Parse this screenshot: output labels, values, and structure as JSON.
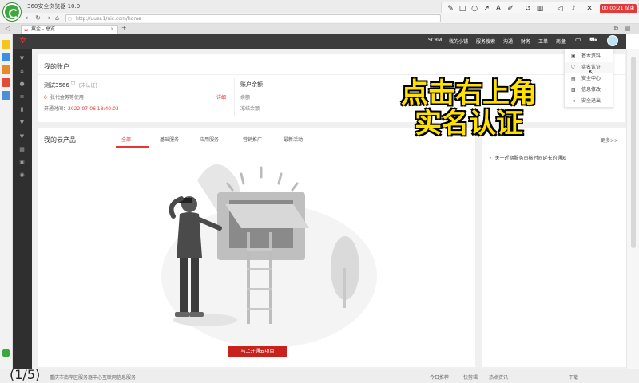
{
  "browser": {
    "title": "360安全浏览器 10.0",
    "url": "http://uuer.1/nic.com/home",
    "tab_label": "翼企 - 总览",
    "tab_close": "×",
    "new_tab": "+"
  },
  "recorder": {
    "timer": "00:00:21 结束"
  },
  "site": {
    "nav": [
      "SCRM",
      "我的小铺",
      "服务搜索",
      "沟通",
      "财务",
      "工单",
      "商盘"
    ]
  },
  "account": {
    "title": "我的账户",
    "username": "测试3566",
    "verify_status": "[未认证]",
    "pending_count": "0",
    "pending_text": "张代金券等使用",
    "details_link": "详细",
    "open_time_label": "开通时间：",
    "open_time_value": "2022-07-06 18:40:03",
    "balance_title": "账户余额",
    "balance_label": "余额",
    "frozen_label": "冻结余额"
  },
  "products": {
    "title": "我的云产品",
    "tabs": [
      "全部",
      "基础服务",
      "应用服务",
      "营销推广",
      "最新活动"
    ],
    "open_button": "马上开通云项目"
  },
  "news": {
    "more": "更多>>",
    "item": "关于近期服务审核时间延长的通知"
  },
  "dropdown": {
    "items": [
      "基本资料",
      "实名认证",
      "安全中心",
      "信息修改",
      "安全退出"
    ]
  },
  "caption": {
    "line1": "点击右上角",
    "line2": "实名认证"
  },
  "statusbar": {
    "page_counter": "(1/5)",
    "text": "重庆市南岸区服务器中心互联网信息服务",
    "items": [
      "今日推荐",
      "快剪辑",
      "热点资讯",
      "下载"
    ]
  },
  "colors": {
    "accent_red": "#c8221e",
    "header_dark": "#3c3c3c",
    "caption_yellow": "#ffe100",
    "brand_green": "#3da840"
  }
}
